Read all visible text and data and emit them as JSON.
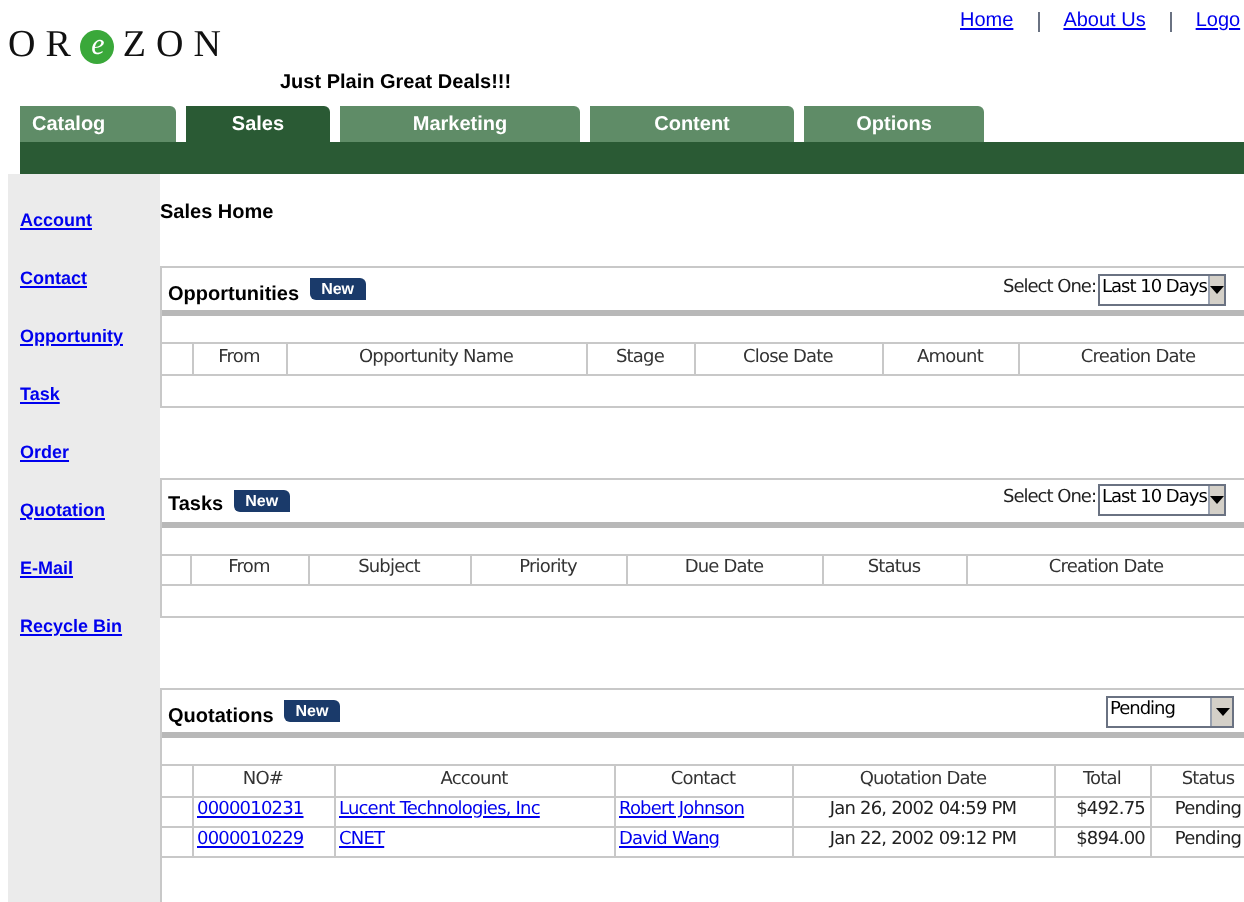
{
  "logo": {
    "before": "OR",
    "mark": "e",
    "after": "ZON"
  },
  "tagline": "Just Plain Great Deals!!!",
  "top_links": [
    "Home",
    "About Us",
    "Logo"
  ],
  "tabs": [
    {
      "label": "Catalog",
      "selected": false
    },
    {
      "label": "Sales",
      "selected": true
    },
    {
      "label": "Marketing",
      "selected": false
    },
    {
      "label": "Content",
      "selected": false
    },
    {
      "label": "Options",
      "selected": false
    }
  ],
  "sidebar": {
    "items": [
      "Account",
      "Contact",
      "Opportunity",
      "Task",
      "Order",
      "Quotation",
      "E-Mail",
      "Recycle Bin"
    ]
  },
  "page_title": "Sales Home",
  "sections": [
    {
      "title": "Opportunities",
      "new_button": "New",
      "filter": {
        "label": "Select One:",
        "value": "Last 10 Days"
      },
      "columns": [
        "From",
        "Opportunity Name",
        "Stage",
        "Close Date",
        "Amount",
        "Creation Date"
      ]
    },
    {
      "title": "Tasks",
      "new_button": "New",
      "filter": {
        "label": "Select One:",
        "value": "Last 10 Days"
      },
      "columns": [
        "From",
        "Subject",
        "Priority",
        "Due Date",
        "Status",
        "Creation Date"
      ]
    },
    {
      "title": "Quotations",
      "new_button": "New",
      "filter": {
        "value": "Pending"
      },
      "columns": [
        "NO#",
        "Account",
        "Contact",
        "Quotation Date",
        "Total",
        "Status"
      ],
      "rows": [
        [
          {
            "kind": "link",
            "text": "0000010231"
          },
          {
            "kind": "link",
            "text": "Lucent Technologies, Inc"
          },
          {
            "kind": "link",
            "text": "Robert Johnson"
          },
          {
            "kind": "text",
            "text": "Jan 26, 2002 04:59 PM"
          },
          {
            "kind": "amount",
            "text": "$492.75"
          },
          {
            "kind": "text",
            "text": "Pending"
          }
        ],
        [
          {
            "kind": "link",
            "text": "0000010229"
          },
          {
            "kind": "link",
            "text": "CNET"
          },
          {
            "kind": "link",
            "text": "David Wang"
          },
          {
            "kind": "text",
            "text": "Jan 22, 2002 09:12 PM"
          },
          {
            "kind": "amount",
            "text": "$894.00"
          },
          {
            "kind": "text",
            "text": "Pending"
          }
        ]
      ]
    }
  ]
}
